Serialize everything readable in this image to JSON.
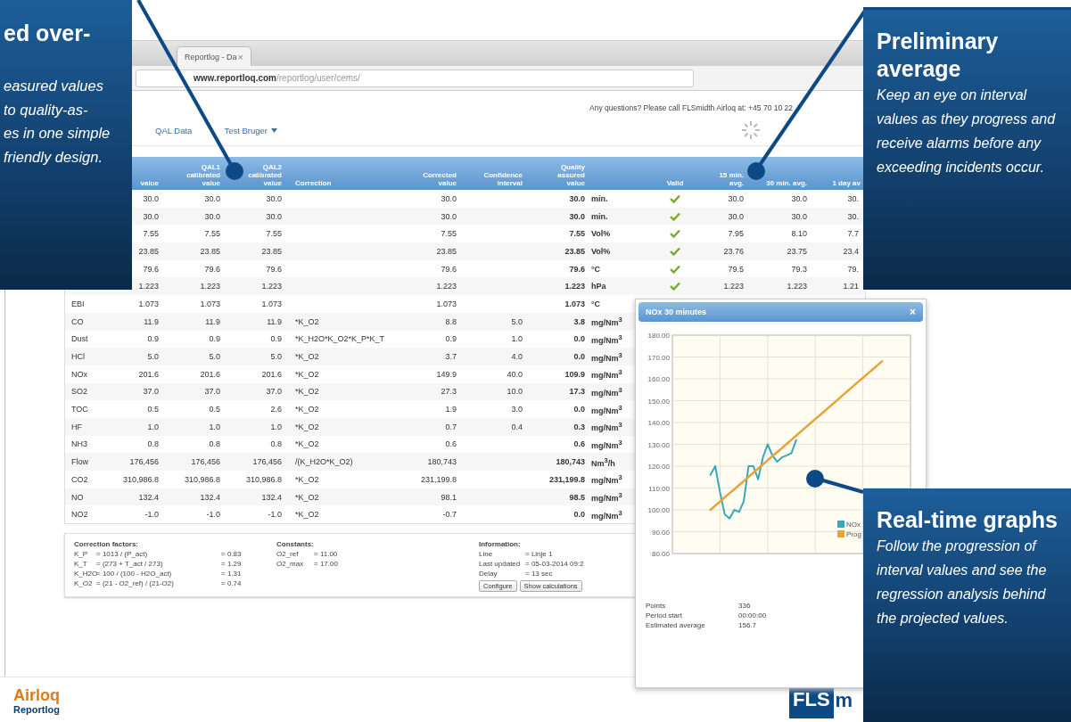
{
  "browser": {
    "tab_title": "Reportlog - Da",
    "tab_close": "×",
    "url_host": "www.reportloq.com",
    "url_path": "/reportlog/user/cems/"
  },
  "header": {
    "contact": "Any questions? Please call FLSmidth Airloq at: +45 70 10 22"
  },
  "nav": [
    {
      "label": "QAL Data",
      "dropdown": false
    },
    {
      "label": "Test Bruger",
      "dropdown": true
    }
  ],
  "table": {
    "columns": [
      "value",
      "QAL1 calibrated value",
      "QAL2 calibrated value",
      "Correction",
      "Corrected value",
      "Confidence interval",
      "Quality assured value",
      null,
      "Valid",
      "15 min. avg.",
      "30 min. avg.",
      "1 day av"
    ],
    "rows": [
      {
        "cells": [
          "30.0",
          "30.0",
          "30.0",
          null,
          "30.0",
          null,
          "30.0"
        ],
        "unit": "min.",
        "valid": true,
        "averages": [
          "30.0",
          "30.0",
          "30."
        ]
      },
      {
        "cells": [
          "30.0",
          "30.0",
          "30.0",
          null,
          "30.0",
          null,
          "30.0"
        ],
        "unit": "min.",
        "valid": true,
        "averages": [
          "30.0",
          "30.0",
          "30."
        ]
      },
      {
        "cells": [
          "7.55",
          "7.55",
          "7.55",
          null,
          "7.55",
          null,
          "7.55"
        ],
        "unit": "Vol%",
        "valid": true,
        "averages": [
          "7.95",
          "8.10",
          "7.7"
        ]
      },
      {
        "cells": [
          "23.85",
          "23.85",
          "23.85",
          null,
          "23.85",
          null,
          "23.85"
        ],
        "unit": "Vol%",
        "valid": true,
        "averages": [
          "23.76",
          "23.75",
          "23.4"
        ]
      },
      {
        "cells": [
          "79.6",
          "79.6",
          "79.6",
          null,
          "79.6",
          null,
          "79.6"
        ],
        "unit": "°C",
        "valid": true,
        "averages": [
          "79.5",
          "79.3",
          "79."
        ]
      },
      {
        "cells": [
          "1.223",
          "1.223",
          "1.223",
          null,
          "1.223",
          null,
          "1.223"
        ],
        "unit": "hPa",
        "valid": true,
        "averages": [
          "1.223",
          "1.223",
          "1.21"
        ]
      },
      {
        "name": "EBI",
        "cells": [
          "1.073",
          "1.073",
          "1.073",
          null,
          "1.073",
          null,
          "1.073"
        ],
        "unit": "°C"
      },
      {
        "name": "CO",
        "cells": [
          "11.9",
          "11.9",
          "11.9",
          "*K_O2",
          "8.8",
          "5.0",
          "3.8"
        ],
        "unit": "mg/Nm$^{3}$"
      },
      {
        "name": "Dust",
        "cells": [
          "0.9",
          "0.9",
          "0.9",
          "*K_H2O*K_O2*K_P*K_T",
          "0.9",
          "1.0",
          "0.0"
        ],
        "unit": "mg/Nm$^{3}$"
      },
      {
        "name": "HCl",
        "cells": [
          "5.0",
          "5.0",
          "5.0",
          "*K_O2",
          "3.7",
          "4.0",
          "0.0"
        ],
        "unit": "mg/Nm$^{3}$"
      },
      {
        "name": "NOx",
        "cells": [
          "201.6",
          "201.6",
          "201.6",
          "*K_O2",
          "149.9",
          "40.0",
          "109.9"
        ],
        "unit": "mg/Nm$^{3}$"
      },
      {
        "name": "SO2",
        "cells": [
          "37.0",
          "37.0",
          "37.0",
          "*K_O2",
          "27.3",
          "10.0",
          "17.3"
        ],
        "unit": "mg/Nm$^{3}$"
      },
      {
        "name": "TOC",
        "cells": [
          "0.5",
          "0.5",
          "2.6",
          "*K_O2",
          "1.9",
          "3.0",
          "0.0"
        ],
        "unit": "mg/Nm$^{3}$"
      },
      {
        "name": "HF",
        "cells": [
          "1.0",
          "1.0",
          "1.0",
          "*K_O2",
          "0.7",
          "0.4",
          "0.3"
        ],
        "unit": "mg/Nm$^{3}$"
      },
      {
        "name": "NH3",
        "cells": [
          "0.8",
          "0.8",
          "0.8",
          "*K_O2",
          "0.6",
          null,
          "0.6"
        ],
        "unit": "mg/Nm$^{3}$"
      },
      {
        "name": "Flow",
        "cells": [
          "176,456",
          "176,456",
          "176,456",
          "/(K_H2O*K_O2)",
          "180,743",
          null,
          "180,743"
        ],
        "unit": "Nm$^{3}$/h"
      },
      {
        "name": "CO2",
        "cells": [
          "310,986.8",
          "310,986.8",
          "310,986.8",
          "*K_O2",
          "231,199.8",
          null,
          "231,199.8"
        ],
        "unit": "mg/Nm$^{3}$"
      },
      {
        "name": "NO",
        "cells": [
          "132.4",
          "132.4",
          "132.4",
          "*K_O2",
          "98.1",
          null,
          "98.5"
        ],
        "unit": "mg/Nm$^{3}$"
      },
      {
        "name": "NO2",
        "cells": [
          "-1.0",
          "-1.0",
          "-1.0",
          "*K_O2",
          "-0.7",
          null,
          "0.0"
        ],
        "unit": "mg/Nm$^{3}$"
      }
    ]
  },
  "correction_factors": {
    "title": "Correction factors:",
    "rows": [
      {
        "name": "K_P",
        "formula": "= 1013 / (P_act)",
        "value": "= 0.83"
      },
      {
        "name": "K_T",
        "formula": "= (273 + T_act / 273)",
        "value": "= 1.29"
      },
      {
        "name": "K_H2O",
        "formula": "= 100 / (100 - H2O_act)",
        "value": "= 1.31"
      },
      {
        "name": "K_O2",
        "formula": "= (21 - O2_ref) / (21-O2)",
        "value": "= 0.74"
      }
    ]
  },
  "constants": {
    "title": "Constants:",
    "rows": [
      {
        "name": "O2_ref",
        "value": "= 11.00"
      },
      {
        "name": "O2_max",
        "value": "= 17.00"
      }
    ]
  },
  "information": {
    "title": "Information:",
    "rows": [
      {
        "name": "Line",
        "value": "= Linje 1"
      },
      {
        "name": "Last updated",
        "value": "= 05-03-2014 09:2"
      },
      {
        "name": "Delay",
        "value": "= 13 sec"
      }
    ],
    "buttons": [
      "Configure",
      "Show calculations"
    ]
  },
  "popup": {
    "title": "NOx 30 minutes",
    "close": "×",
    "chart_data": {
      "type": "line",
      "ylim": [
        80,
        180
      ],
      "grid": true,
      "legend": "lower right",
      "yticks": [
        {
          "value": 180,
          "label": "180.00"
        },
        {
          "value": 170,
          "label": "170.00"
        },
        {
          "value": 160,
          "label": "160.00"
        },
        {
          "value": 150,
          "label": "150.00"
        },
        {
          "value": 140,
          "label": "140.00"
        },
        {
          "value": 130,
          "label": "130.00"
        },
        {
          "value": 120,
          "label": "120.00"
        },
        {
          "value": 110,
          "label": "110.00"
        },
        {
          "value": 100,
          "label": "100.00"
        },
        {
          "value": 90,
          "label": "90.00"
        },
        {
          "value": 80,
          "label": "80.00"
        }
      ],
      "categories": [
        null,
        null,
        null,
        null,
        null,
        null,
        null,
        null,
        null,
        null,
        null,
        null,
        null,
        null,
        null,
        null,
        null,
        null,
        null,
        null,
        null,
        null,
        null,
        null,
        null,
        null,
        null,
        null,
        null,
        null,
        null,
        null,
        null,
        null,
        null,
        null,
        null,
        null,
        null,
        null,
        null,
        null,
        null,
        null,
        null,
        null,
        null,
        null,
        null,
        null,
        null
      ],
      "series": [
        {
          "name": "NOx",
          "color": "#3aa6b9",
          "values": [
            null,
            null,
            null,
            null,
            null,
            null,
            null,
            null,
            116,
            120,
            108,
            98,
            96,
            100,
            99,
            104,
            120,
            120,
            114,
            124,
            130,
            125,
            122,
            124,
            125,
            126,
            132,
            null,
            null,
            null,
            null,
            null,
            null,
            null,
            null,
            null,
            null,
            null,
            null,
            null,
            null,
            null,
            null,
            null,
            null,
            null,
            null,
            null,
            null,
            null,
            null
          ]
        },
        {
          "name": "Prog",
          "color": "#e8a33a",
          "values": [
            null,
            null,
            null,
            null,
            null,
            null,
            null,
            null,
            100,
            101.9,
            103.8,
            105.7,
            107.6,
            109.4,
            111.3,
            113.2,
            115.1,
            117,
            118.9,
            120.8,
            122.7,
            124.6,
            126.4,
            128.3,
            130.2,
            132.1,
            134,
            135.9,
            137.8,
            139.7,
            141.6,
            143.4,
            145.3,
            147.2,
            149.1,
            151,
            152.9,
            154.8,
            156.7,
            158.6,
            160.4,
            162.3,
            164.2,
            166.1,
            168,
            null,
            null,
            null,
            null,
            null,
            null
          ]
        }
      ]
    },
    "stats": [
      {
        "label": "Points",
        "value": "336"
      },
      {
        "label": "Period start",
        "value": "00:00:00"
      },
      {
        "label": "Estimated average",
        "value": "156.7"
      }
    ]
  },
  "footer": {
    "brand": "Airloq",
    "product": "Reportlog",
    "logo_box": "FLS",
    "logo_rest": "m"
  },
  "callouts": [
    {
      "title": "ed over-",
      "lines": [
        "easured values",
        "to quality-as-",
        "es in one simple",
        "friendly design."
      ]
    },
    {
      "title": "Preliminary average",
      "text": "Keep an eye on interval values as they progress and receive alarms before any exceeding incidents occur."
    },
    {
      "title": "Real-time graphs",
      "text": "Follow the progression of interval values and see the regression analysis behind the projected values."
    }
  ]
}
